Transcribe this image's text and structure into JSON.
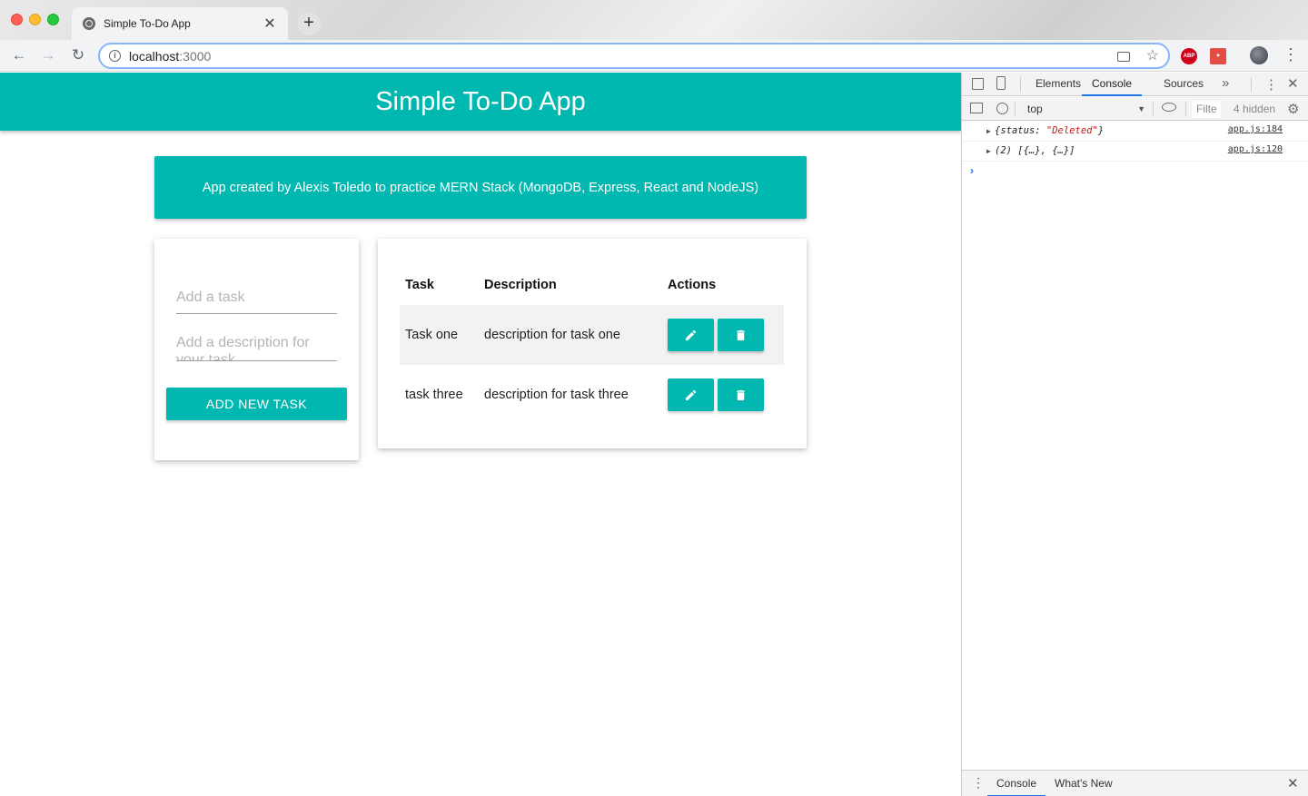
{
  "browser": {
    "tab_title": "Simple To-Do App",
    "tab_close": "✕",
    "new_tab": "+",
    "url_host": "localhost",
    "url_port": ":3000",
    "ext_abp": "ABP"
  },
  "app": {
    "title": "Simple To-Do App",
    "banner": "App created by Alexis Toledo to practice MERN Stack (MongoDB, Express, React and NodeJS)",
    "accent_color": "#00b8b0",
    "form": {
      "task_placeholder": "Add a task",
      "description_placeholder": "Add a description for your task",
      "add_button": "ADD NEW TASK"
    },
    "table": {
      "headers": {
        "task": "Task",
        "description": "Description",
        "actions": "Actions"
      },
      "rows": [
        {
          "task": "Task one",
          "description": "description for task one"
        },
        {
          "task": "task three",
          "description": "description for task three"
        }
      ]
    }
  },
  "devtools": {
    "tabs": [
      "Elements",
      "Console",
      "Sources"
    ],
    "active_tab": "Console",
    "more": "»",
    "context": "top",
    "filter": "Filte",
    "hidden": "4 hidden",
    "logs": [
      {
        "prefix": "{status: ",
        "string": "\"Deleted\"",
        "suffix": "}",
        "source": "app.js:184"
      },
      {
        "prefix": "(2) [{…}, {…}]",
        "string": "",
        "suffix": "",
        "source": "app.js:120"
      }
    ],
    "prompt": "›",
    "drawer_tabs": [
      "Console",
      "What's New"
    ]
  }
}
